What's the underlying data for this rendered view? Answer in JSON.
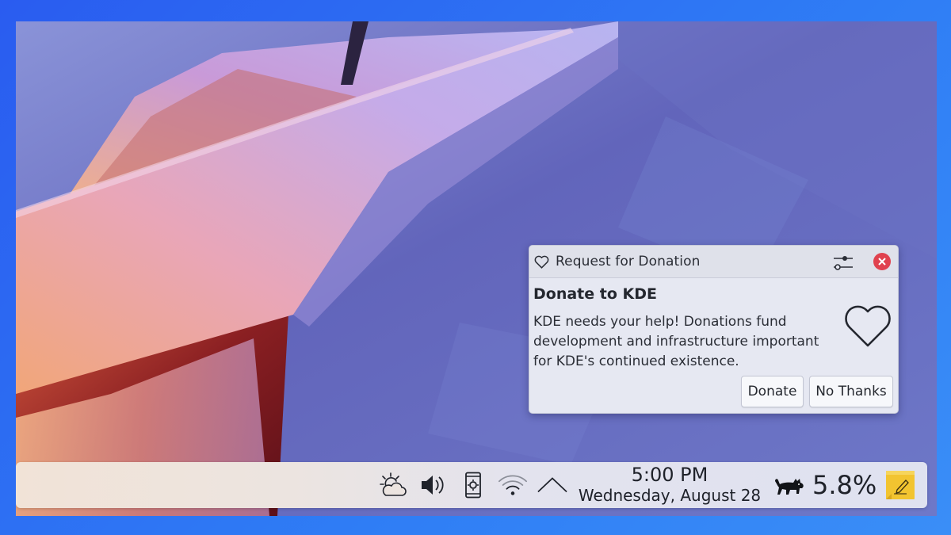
{
  "notification": {
    "app_name": "Request for Donation",
    "title": "Donate to KDE",
    "body": "KDE needs your help! Donations fund development and infrastructure important for KDE's continued existence.",
    "actions": {
      "donate": "Donate",
      "no_thanks": "No Thanks"
    },
    "icons": {
      "header": "heart-icon",
      "configure": "sliders-icon",
      "close": "close-icon",
      "main": "heart-icon"
    },
    "colors": {
      "close_button": "#e0424f"
    }
  },
  "panel": {
    "tray_icons": [
      "weather-icon",
      "volume-icon",
      "kdeconnect-icon",
      "wifi-icon",
      "expand-tray-icon"
    ],
    "clock": {
      "time": "5:00 PM",
      "date": "Wednesday, August 28"
    },
    "cpu_monitor": {
      "icon": "cat-icon",
      "value": "5.8%"
    },
    "notes_icon": "sticky-note-icon"
  }
}
